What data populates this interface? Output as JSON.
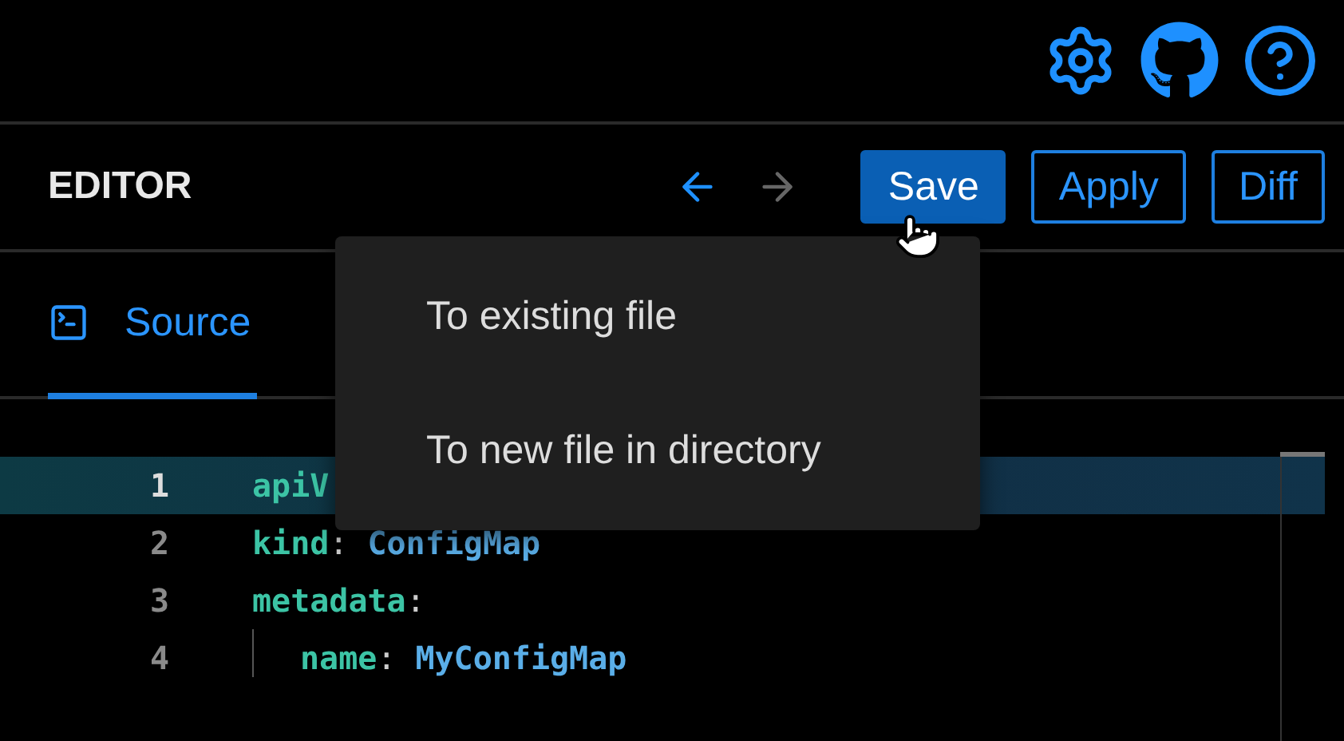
{
  "header_icons": [
    {
      "kind": "settings"
    },
    {
      "kind": "github"
    },
    {
      "kind": "help"
    }
  ],
  "editor": {
    "title": "EDITOR",
    "nav": [
      {
        "kind": "back",
        "disabled": false
      },
      {
        "kind": "forward",
        "disabled": true
      }
    ],
    "buttons": [
      {
        "label": "Save",
        "kind": "primary"
      },
      {
        "label": "Apply",
        "kind": "outline"
      },
      {
        "label": "Diff",
        "kind": "outline"
      }
    ]
  },
  "tabs": [
    {
      "label": "Source",
      "selected": true
    }
  ],
  "save_menu": {
    "items": [
      "To existing file",
      "To new file in directory"
    ]
  },
  "code": [
    {
      "number": "1",
      "key": "apiV",
      "current": true
    },
    {
      "number": "2",
      "key": "kind",
      "sep": ":",
      "value": "ConfigMap",
      "current": false
    },
    {
      "number": "3",
      "key": "metadata",
      "sep": ":",
      "current": false,
      "children": [
        {
          "number": "4",
          "key": "name",
          "sep": ":",
          "value": "MyConfigMap",
          "current": false
        }
      ]
    }
  ]
}
